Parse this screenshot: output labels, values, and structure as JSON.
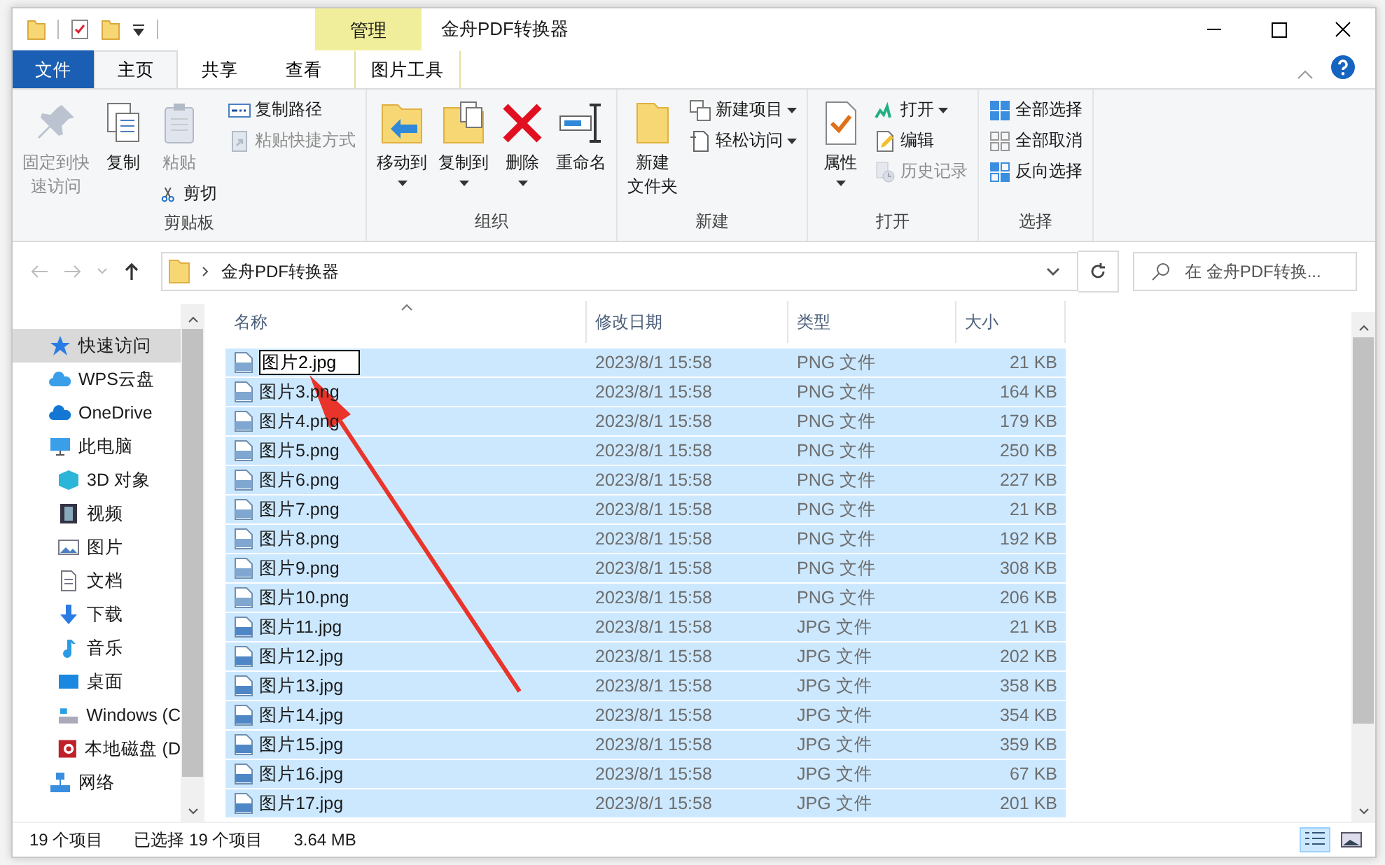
{
  "window": {
    "title": "金舟PDF转换器",
    "context_label": "管理"
  },
  "ribbon_tabs": [
    {
      "label": "文件",
      "selected": false,
      "kind": "file"
    },
    {
      "label": "主页",
      "selected": true,
      "kind": "normal"
    },
    {
      "label": "共享",
      "selected": false,
      "kind": "normal"
    },
    {
      "label": "查看",
      "selected": false,
      "kind": "normal"
    },
    {
      "label": "图片工具",
      "selected": false,
      "kind": "context"
    }
  ],
  "ribbon_groups": [
    {
      "label": "剪贴板",
      "columns": [
        [
          {
            "kind": "large",
            "lines": [
              "固定到快",
              "速访问"
            ],
            "disabled": true,
            "dropdown": false
          }
        ],
        [
          {
            "kind": "large",
            "lines": [
              "复制"
            ],
            "disabled": false,
            "dropdown": false
          }
        ],
        [
          {
            "kind": "large",
            "lines": [
              "粘贴"
            ],
            "disabled": true,
            "dropdown": false
          },
          {
            "kind": "small",
            "lines": [
              "剪切"
            ],
            "disabled": false,
            "dropdown": false
          }
        ],
        [
          {
            "kind": "small",
            "lines": [
              "复制路径"
            ],
            "disabled": false,
            "dropdown": false
          },
          {
            "kind": "small",
            "lines": [
              "粘贴快捷方式"
            ],
            "disabled": true,
            "dropdown": false
          }
        ]
      ]
    },
    {
      "label": "组织",
      "columns": [
        [
          {
            "kind": "large",
            "lines": [
              "移动到"
            ],
            "disabled": false,
            "dropdown": true
          }
        ],
        [
          {
            "kind": "large",
            "lines": [
              "复制到"
            ],
            "disabled": false,
            "dropdown": true
          }
        ],
        [
          {
            "kind": "large",
            "lines": [
              "删除"
            ],
            "disabled": false,
            "dropdown": true
          }
        ],
        [
          {
            "kind": "large",
            "lines": [
              "重命名"
            ],
            "disabled": false,
            "dropdown": false
          }
        ]
      ]
    },
    {
      "label": "新建",
      "columns": [
        [
          {
            "kind": "large",
            "lines": [
              "新建",
              "文件夹"
            ],
            "disabled": false,
            "dropdown": false
          }
        ],
        [
          {
            "kind": "small",
            "lines": [
              "新建项目"
            ],
            "disabled": false,
            "dropdown": true
          },
          {
            "kind": "small",
            "lines": [
              "轻松访问"
            ],
            "disabled": false,
            "dropdown": true
          }
        ]
      ]
    },
    {
      "label": "打开",
      "columns": [
        [
          {
            "kind": "large",
            "lines": [
              "属性"
            ],
            "disabled": false,
            "dropdown": true
          }
        ],
        [
          {
            "kind": "small",
            "lines": [
              "打开"
            ],
            "disabled": false,
            "dropdown": true
          },
          {
            "kind": "small",
            "lines": [
              "编辑"
            ],
            "disabled": false,
            "dropdown": false
          },
          {
            "kind": "small",
            "lines": [
              "历史记录"
            ],
            "disabled": true,
            "dropdown": false
          }
        ]
      ]
    },
    {
      "label": "选择",
      "columns": [
        [
          {
            "kind": "small",
            "lines": [
              "全部选择"
            ],
            "disabled": false,
            "dropdown": false
          },
          {
            "kind": "small",
            "lines": [
              "全部取消"
            ],
            "disabled": false,
            "dropdown": false
          },
          {
            "kind": "small",
            "lines": [
              "反向选择"
            ],
            "disabled": false,
            "dropdown": false
          }
        ]
      ]
    }
  ],
  "address": {
    "crumb": "金舟PDF转换器",
    "search_placeholder": "在 金舟PDF转换..."
  },
  "nav": [
    {
      "label": "快速访问",
      "selected": true
    },
    {
      "label": "WPS云盘",
      "selected": false
    },
    {
      "label": "OneDrive",
      "selected": false
    },
    {
      "label": "此电脑",
      "selected": false,
      "children": [
        {
          "label": "3D 对象",
          "selected": false
        },
        {
          "label": "视频",
          "selected": false
        },
        {
          "label": "图片",
          "selected": false
        },
        {
          "label": "文档",
          "selected": false
        },
        {
          "label": "下载",
          "selected": false
        },
        {
          "label": "音乐",
          "selected": false
        },
        {
          "label": "桌面",
          "selected": false
        },
        {
          "label": "Windows (C",
          "selected": false
        },
        {
          "label": "本地磁盘 (D",
          "selected": false
        }
      ]
    },
    {
      "label": "网络",
      "selected": false
    }
  ],
  "table": {
    "columns": [
      "名称",
      "修改日期",
      "类型",
      "大小"
    ],
    "rows": [
      {
        "name": "图片2.jpg",
        "date": "2023/8/1 15:58",
        "type": "PNG 文件",
        "size": "21 KB",
        "kind": "png",
        "selected": true,
        "editing": true
      },
      {
        "name": "图片3.png",
        "date": "2023/8/1 15:58",
        "type": "PNG 文件",
        "size": "164 KB",
        "kind": "png",
        "selected": true,
        "editing": false
      },
      {
        "name": "图片4.png",
        "date": "2023/8/1 15:58",
        "type": "PNG 文件",
        "size": "179 KB",
        "kind": "png",
        "selected": true,
        "editing": false
      },
      {
        "name": "图片5.png",
        "date": "2023/8/1 15:58",
        "type": "PNG 文件",
        "size": "250 KB",
        "kind": "png",
        "selected": true,
        "editing": false
      },
      {
        "name": "图片6.png",
        "date": "2023/8/1 15:58",
        "type": "PNG 文件",
        "size": "227 KB",
        "kind": "png",
        "selected": true,
        "editing": false
      },
      {
        "name": "图片7.png",
        "date": "2023/8/1 15:58",
        "type": "PNG 文件",
        "size": "21 KB",
        "kind": "png",
        "selected": true,
        "editing": false
      },
      {
        "name": "图片8.png",
        "date": "2023/8/1 15:58",
        "type": "PNG 文件",
        "size": "192 KB",
        "kind": "png",
        "selected": true,
        "editing": false
      },
      {
        "name": "图片9.png",
        "date": "2023/8/1 15:58",
        "type": "PNG 文件",
        "size": "308 KB",
        "kind": "png",
        "selected": true,
        "editing": false
      },
      {
        "name": "图片10.png",
        "date": "2023/8/1 15:58",
        "type": "PNG 文件",
        "size": "206 KB",
        "kind": "png",
        "selected": true,
        "editing": false
      },
      {
        "name": "图片11.jpg",
        "date": "2023/8/1 15:58",
        "type": "JPG 文件",
        "size": "21 KB",
        "kind": "jpg",
        "selected": true,
        "editing": false
      },
      {
        "name": "图片12.jpg",
        "date": "2023/8/1 15:58",
        "type": "JPG 文件",
        "size": "202 KB",
        "kind": "jpg",
        "selected": true,
        "editing": false
      },
      {
        "name": "图片13.jpg",
        "date": "2023/8/1 15:58",
        "type": "JPG 文件",
        "size": "358 KB",
        "kind": "jpg",
        "selected": true,
        "editing": false
      },
      {
        "name": "图片14.jpg",
        "date": "2023/8/1 15:58",
        "type": "JPG 文件",
        "size": "354 KB",
        "kind": "jpg",
        "selected": true,
        "editing": false
      },
      {
        "name": "图片15.jpg",
        "date": "2023/8/1 15:58",
        "type": "JPG 文件",
        "size": "359 KB",
        "kind": "jpg",
        "selected": true,
        "editing": false
      },
      {
        "name": "图片16.jpg",
        "date": "2023/8/1 15:58",
        "type": "JPG 文件",
        "size": "67 KB",
        "kind": "jpg",
        "selected": true,
        "editing": false
      },
      {
        "name": "图片17.jpg",
        "date": "2023/8/1 15:58",
        "type": "JPG 文件",
        "size": "201 KB",
        "kind": "jpg",
        "selected": true,
        "editing": false
      }
    ]
  },
  "status_bar": {
    "count": "19 个项目",
    "selection": "已选择 19 个项目",
    "size": "3.64 MB"
  },
  "view_buttons": [
    {
      "kind": "details",
      "selected": true
    },
    {
      "kind": "thumbnails",
      "selected": false
    }
  ]
}
